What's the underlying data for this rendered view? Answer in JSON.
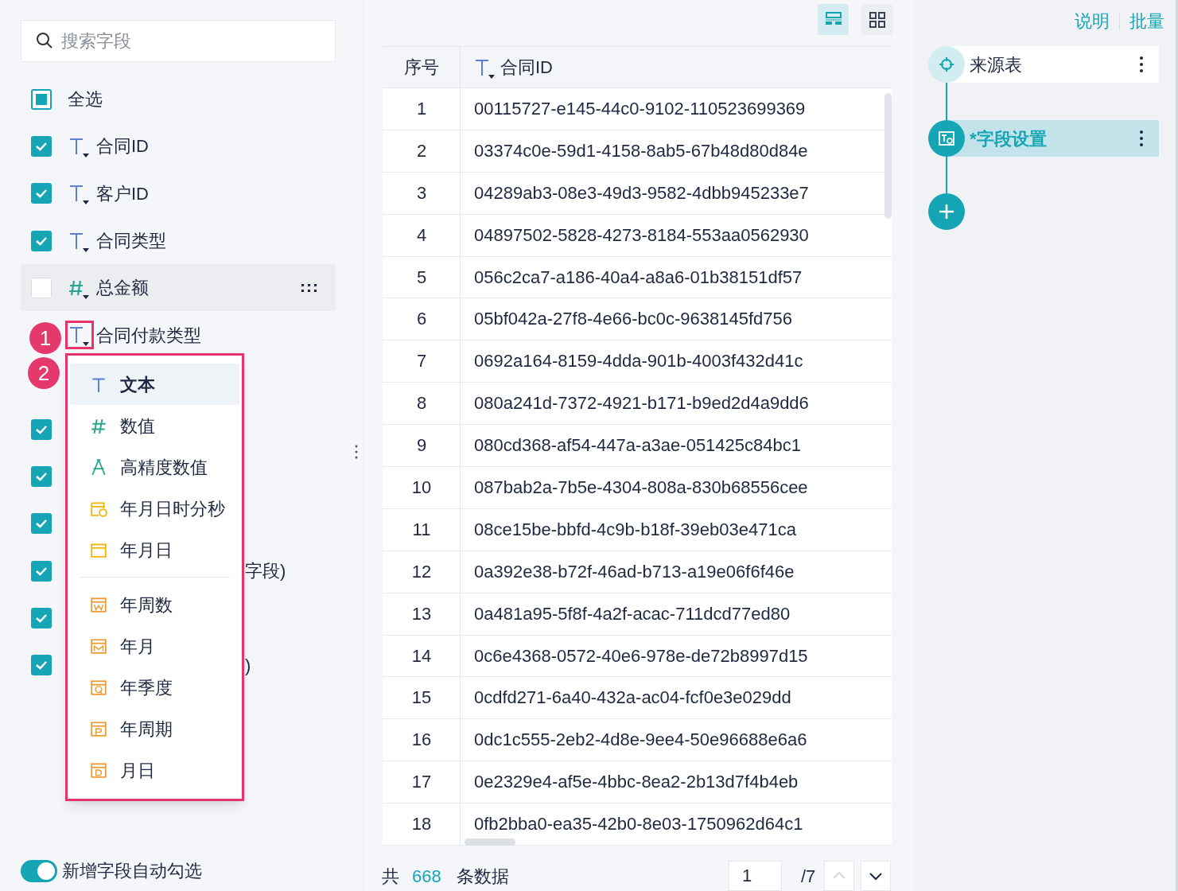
{
  "search": {
    "placeholder": "搜索字段"
  },
  "select_all": {
    "label": "全选",
    "indeterminate": true
  },
  "fields": [
    {
      "label": "合同ID",
      "kind": "text",
      "checked": true,
      "highlighted": false
    },
    {
      "label": "客户ID",
      "kind": "text",
      "checked": true,
      "highlighted": false
    },
    {
      "label": "合同类型",
      "kind": "text",
      "checked": true,
      "highlighted": false
    },
    {
      "label": "总金额",
      "kind": "number",
      "checked": false,
      "highlighted": true
    },
    {
      "label": "合同付款类型",
      "kind": "text",
      "highlighted": false,
      "outlined": true
    },
    {
      "highlighted": false
    },
    {
      "checked": true,
      "highlighted": false
    },
    {
      "checked": true,
      "highlighted": false
    },
    {
      "checked": true,
      "highlighted": false
    },
    {
      "tail": "字段)",
      "checked": true,
      "highlighted": false
    },
    {
      "checked": true,
      "highlighted": false
    },
    {
      "tail": ")",
      "checked": true,
      "highlighted": false
    }
  ],
  "type_menu": {
    "groups": [
      [
        {
          "kind": "text",
          "label": "文本",
          "selected": true
        },
        {
          "kind": "number",
          "label": "数值",
          "selected": false
        },
        {
          "kind": "decimal",
          "label": "高精度数值",
          "selected": false
        },
        {
          "kind": "datetime",
          "label": "年月日时分秒",
          "selected": false
        },
        {
          "kind": "date",
          "label": "年月日",
          "selected": false
        }
      ],
      [
        {
          "kind": "week",
          "label": "年周数",
          "selected": false
        },
        {
          "kind": "month",
          "label": "年月",
          "selected": false
        },
        {
          "kind": "quarter",
          "label": "年季度",
          "selected": false
        },
        {
          "kind": "period",
          "label": "年周期",
          "selected": false
        },
        {
          "kind": "monthday",
          "label": "月日",
          "selected": false
        }
      ]
    ]
  },
  "markers": [
    "1",
    "2"
  ],
  "auto_select": {
    "label": "新增字段自动勾选",
    "on": true
  },
  "view_buttons": [
    {
      "kind": "list",
      "selected": true
    },
    {
      "kind": "grid",
      "selected": false
    }
  ],
  "table": {
    "columns": [
      {
        "label": "序号"
      },
      {
        "label": "合同ID",
        "kind": "text"
      }
    ],
    "rows": [
      [
        "1",
        "00115727-e145-44c0-9102-110523699369"
      ],
      [
        "2",
        "03374c0e-59d1-4158-8ab5-67b48d80d84e"
      ],
      [
        "3",
        "04289ab3-08e3-49d3-9582-4dbb945233e7"
      ],
      [
        "4",
        "04897502-5828-4273-8184-553aa0562930"
      ],
      [
        "5",
        "056c2ca7-a186-40a4-a8a6-01b38151df57"
      ],
      [
        "6",
        "05bf042a-27f8-4e66-bc0c-9638145fd756"
      ],
      [
        "7",
        "0692a164-8159-4dda-901b-4003f432d41c"
      ],
      [
        "8",
        "080a241d-7372-4921-b171-b9ed2d4a9dd6"
      ],
      [
        "9",
        "080cd368-af54-447a-a3ae-051425c84bc1"
      ],
      [
        "10",
        "087bab2a-7b5e-4304-808a-830b68556cee"
      ],
      [
        "11",
        "08ce15be-bbfd-4c9b-b18f-39eb03e471ca"
      ],
      [
        "12",
        "0a392e38-b72f-46ad-b713-a19e06f6f46e"
      ],
      [
        "13",
        "0a481a95-5f8f-4a2f-acac-711dcd77ed80"
      ],
      [
        "14",
        "0c6e4368-0572-40e6-978e-de72b8997d15"
      ],
      [
        "15",
        "0cdfd271-6a40-432a-ac04-fcf0e3e029dd"
      ],
      [
        "16",
        "0dc1c555-2eb2-4d8e-9ee4-50e96688e6a6"
      ],
      [
        "17",
        "0e2329e4-af5e-4bbc-8ea2-2b13d7f4b4eb"
      ],
      [
        "18",
        "0fb2bba0-ea35-42b0-8e03-1750962d64c1"
      ]
    ]
  },
  "footer": {
    "prefix": "共",
    "count": "668",
    "suffix": "条数据",
    "page": "1",
    "total": "/7",
    "prev_disabled": true,
    "next_disabled": false
  },
  "links": [
    "说明",
    "批量"
  ],
  "steps": [
    {
      "kind": "source",
      "label": "来源表",
      "selected": false
    },
    {
      "kind": "fields",
      "label": "*字段设置",
      "selected": true
    }
  ]
}
